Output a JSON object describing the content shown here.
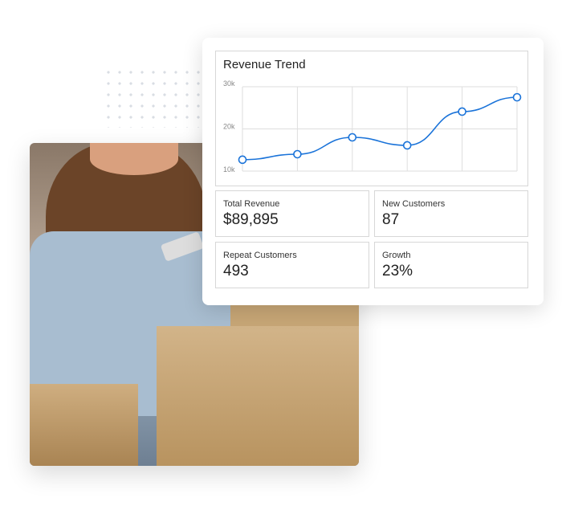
{
  "card": {
    "chart_title": "Revenue Trend",
    "stats": [
      {
        "label": "Total Revenue",
        "value": "$89,895"
      },
      {
        "label": "New Customers",
        "value": "87"
      },
      {
        "label": "Repeat Customers",
        "value": "493"
      },
      {
        "label": "Growth",
        "value": "23%"
      }
    ]
  },
  "chart_data": {
    "type": "line",
    "title": "Revenue Trend",
    "x": [
      1,
      2,
      3,
      4,
      5,
      6
    ],
    "values": [
      12700,
      14000,
      18000,
      16100,
      24100,
      27500
    ],
    "yticks": [
      "10k",
      "20k",
      "30k"
    ],
    "ylim": [
      10000,
      30000
    ],
    "grid": true,
    "color": "#1a73d9"
  }
}
